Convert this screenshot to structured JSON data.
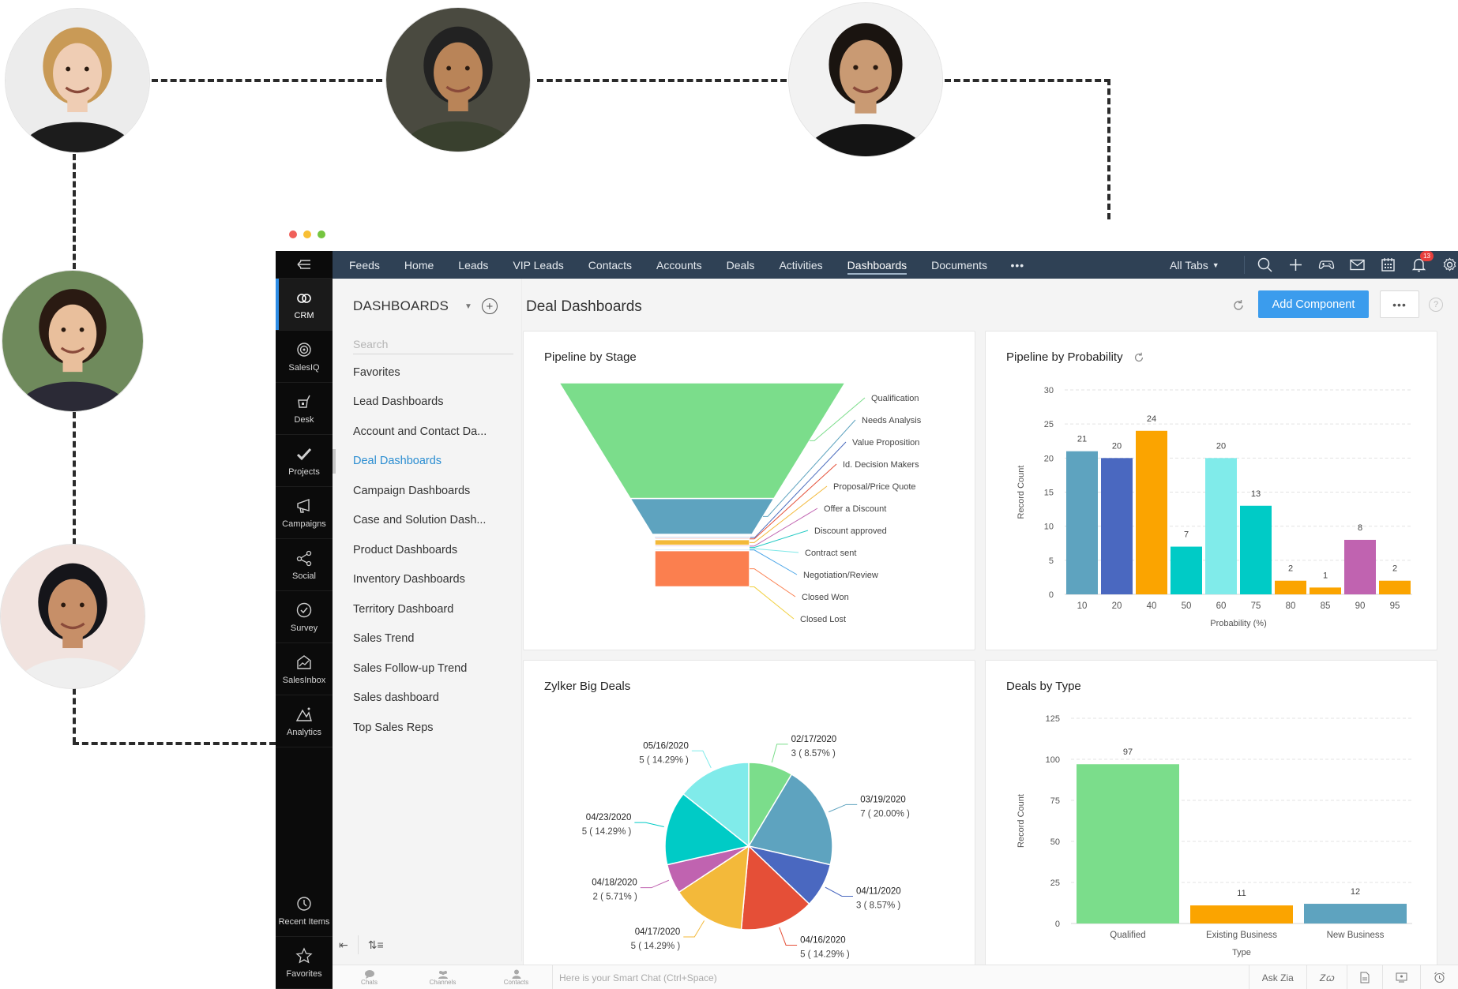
{
  "window": {
    "dots": [
      "#f0605a",
      "#f8bf34",
      "#75c53f"
    ]
  },
  "people": [
    {
      "name": "person-avatar-1",
      "skin": "#efcdb4",
      "hair": "#c99a56",
      "shirt": "#1c1c1c",
      "bg": "#ececec"
    },
    {
      "name": "person-avatar-2",
      "skin": "#b98458",
      "hair": "#222222",
      "shirt": "#39402e",
      "bg": "#4a4a40"
    },
    {
      "name": "person-avatar-3",
      "skin": "#c99a73",
      "hair": "#1a1410",
      "shirt": "#141414",
      "bg": "#f2f2f2"
    },
    {
      "name": "person-avatar-4",
      "skin": "#e9bf9c",
      "hair": "#2a1a12",
      "shirt": "#2b2a36",
      "bg": "#6f8a5c"
    },
    {
      "name": "person-avatar-5",
      "skin": "#c78f68",
      "hair": "#15151a",
      "shirt": "#efefef",
      "bg": "#f1e3df"
    }
  ],
  "rail": {
    "collapse_icon": "collapse-menu-icon",
    "items": [
      {
        "label": "CRM",
        "icon": "crm-icon",
        "active": true
      },
      {
        "label": "SalesIQ",
        "icon": "salesiq-icon"
      },
      {
        "label": "Desk",
        "icon": "desk-icon"
      },
      {
        "label": "Projects",
        "icon": "projects-icon"
      },
      {
        "label": "Campaigns",
        "icon": "campaigns-icon"
      },
      {
        "label": "Social",
        "icon": "social-icon"
      },
      {
        "label": "Survey",
        "icon": "survey-icon"
      },
      {
        "label": "SalesInbox",
        "icon": "salesinbox-icon"
      },
      {
        "label": "Analytics",
        "icon": "analytics-icon"
      }
    ],
    "bottom": [
      {
        "label": "Recent Items",
        "icon": "recent-items-icon"
      },
      {
        "label": "Favorites",
        "icon": "favorites-star-icon"
      }
    ]
  },
  "topnav": {
    "tabs": [
      "Feeds",
      "Home",
      "Leads",
      "VIP Leads",
      "Contacts",
      "Accounts",
      "Deals",
      "Activities",
      "Dashboards",
      "Documents"
    ],
    "active_tab": "Dashboards",
    "more": "•••",
    "all_tabs": "All Tabs",
    "notification_count": "13"
  },
  "dashboards_panel": {
    "title": "DASHBOARDS",
    "search_placeholder": "Search",
    "items": [
      "Favorites",
      "Lead Dashboards",
      "Account and Contact Da...",
      "Deal Dashboards",
      "Campaign Dashboards",
      "Case and Solution Dash...",
      "Product Dashboards",
      "Inventory Dashboards",
      "Territory Dashboard",
      "Sales Trend",
      "Sales Follow-up Trend",
      "Sales dashboard",
      "Top Sales Reps"
    ],
    "active_item": "Deal Dashboards"
  },
  "main": {
    "title": "Deal Dashboards",
    "add_component": "Add Component",
    "more": "•••",
    "help": "?"
  },
  "bottombar": {
    "items": [
      "Chats",
      "Channels",
      "Contacts"
    ],
    "smart_chat_placeholder": "Here is your Smart Chat (Ctrl+Space)",
    "ask_zia": "Ask Zia"
  },
  "chart_data": [
    {
      "type": "funnel",
      "title": "Pipeline by Stage",
      "categories": [
        "Qualification",
        "Needs Analysis",
        "Value Proposition",
        "Id. Decision Makers",
        "Proposal/Price Quote",
        "Offer a Discount",
        "Discount approved",
        "Contract sent",
        "Negotiation/Review",
        "Closed Won",
        "Closed Lost"
      ],
      "values": [
        55,
        17,
        0.3,
        0.3,
        1.2,
        0.3,
        0.2,
        0.2,
        0.3,
        7.5,
        0
      ],
      "colors": [
        "#7bdd8b",
        "#5ea3bf",
        "#4a6bbd",
        "#e5513a",
        "#f3b93a",
        "#c063b0",
        "#1cc8c2",
        "#7fe8e8",
        "#4da6e8",
        "#fb7f4f",
        "#f1d040"
      ]
    },
    {
      "type": "bar",
      "title": "Pipeline by Probability",
      "xlabel": "Probability (%)",
      "ylabel": "Record Count",
      "categories": [
        "10",
        "20",
        "40",
        "50",
        "60",
        "75",
        "80",
        "85",
        "90",
        "95"
      ],
      "values": [
        21,
        20,
        24,
        7,
        20,
        13,
        2,
        1,
        8,
        2
      ],
      "colors": [
        "#5ea3bf",
        "#4a68c0",
        "#fba400",
        "#00cbc6",
        "#80ebea",
        "#00cbc6",
        "#fba400",
        "#fba400",
        "#c063b0",
        "#fba400"
      ],
      "yticks": [
        0,
        5,
        10,
        15,
        20,
        25,
        30
      ],
      "ylim": [
        0,
        30
      ],
      "grid": true
    },
    {
      "type": "pie",
      "title": "Zylker Big Deals",
      "slices": [
        {
          "label": "02/17/2020",
          "value": 3,
          "pct": "8.57%",
          "color": "#7bdd8b"
        },
        {
          "label": "03/19/2020",
          "value": 7,
          "pct": "20.00%",
          "color": "#5ea3bf"
        },
        {
          "label": "04/11/2020",
          "value": 3,
          "pct": "8.57%",
          "color": "#4a68c0"
        },
        {
          "label": "04/16/2020",
          "value": 5,
          "pct": "14.29%",
          "color": "#e54f37"
        },
        {
          "label": "04/17/2020",
          "value": 5,
          "pct": "14.29%",
          "color": "#f3b93a"
        },
        {
          "label": "04/18/2020",
          "value": 2,
          "pct": "5.71%",
          "color": "#c063b0"
        },
        {
          "label": "04/23/2020",
          "value": 5,
          "pct": "14.29%",
          "color": "#00cbc6"
        },
        {
          "label": "05/16/2020",
          "value": 5,
          "pct": "14.29%",
          "color": "#80ebea"
        }
      ]
    },
    {
      "type": "bar",
      "title": "Deals by Type",
      "xlabel": "Type",
      "ylabel": "Record Count",
      "categories": [
        "Qualified",
        "Existing Business",
        "New Business"
      ],
      "values": [
        97,
        11,
        12
      ],
      "colors": [
        "#7bdd8b",
        "#fba400",
        "#5ea3bf"
      ],
      "yticks": [
        0,
        25,
        50,
        75,
        100,
        125
      ],
      "ylim": [
        0,
        125
      ],
      "grid": true
    }
  ]
}
